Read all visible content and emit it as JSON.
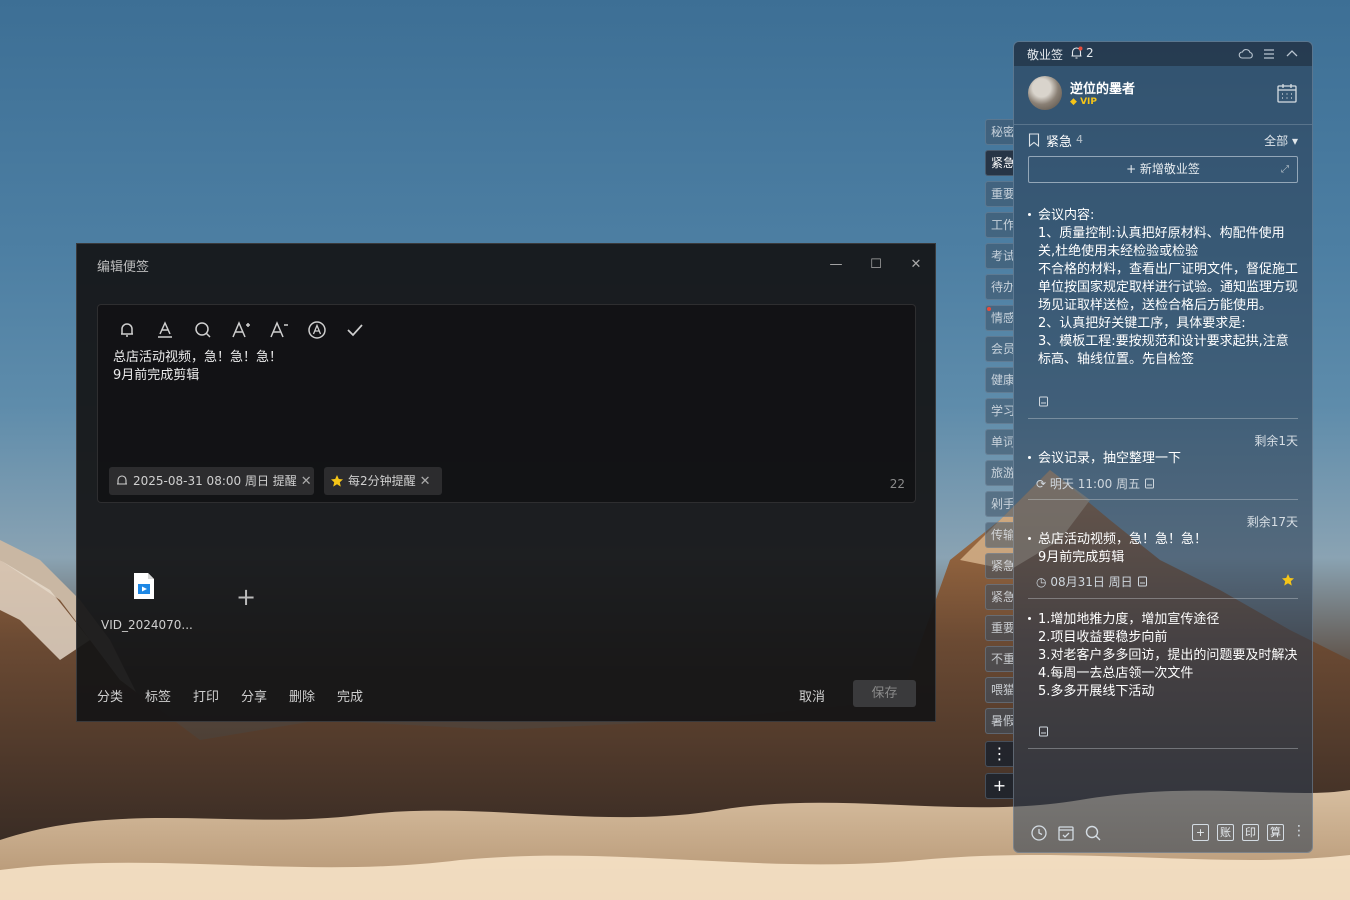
{
  "editor": {
    "title": "编辑便签",
    "note_line1": "总店活动视频，急！急！急！",
    "note_line2": "9月前完成剪辑",
    "reminder_tag": "2025-08-31 08:00 周日 提醒",
    "repeat_tag": "每2分钟提醒",
    "char_count": "22",
    "attachment_name": "VID_2024070...",
    "actions": [
      "分类",
      "标签",
      "打印",
      "分享",
      "删除",
      "完成"
    ],
    "cancel": "取消",
    "save": "保存"
  },
  "side_tabs": [
    "秘密",
    "紧急",
    "重要",
    "工作",
    "考试",
    "待办",
    "情感",
    "会员",
    "健康",
    "学习",
    "单词",
    "旅游",
    "剁手",
    "传输",
    "紧急",
    "紧急",
    "重要",
    "不重",
    "喂猫",
    "暑假"
  ],
  "panel": {
    "app_name": "敬业签",
    "notification_count": "2",
    "user_name": "逆位的墨者",
    "vip": "VIP",
    "category": "紧急",
    "category_count": "4",
    "filter": "全部",
    "new_note": "+ 新增敬业签",
    "notes": [
      {
        "text": "会议内容:\n1、质量控制:认真把好原材料、构配件使用关,杜绝使用未经检验或检验\n不合格的材料，查看出厂证明文件，督促施工单位按国家规定取样进行试验。通知监理方现场见证取样送检，送检合格后方能使用。\n2、认真把好关键工序，具体要求是:\n3、模板工程:要按规范和设计要求起拱,注意标高、轴线位置。先自检签"
      },
      {
        "remain": "剩余1天",
        "text": "会议记录，抽空整理一下",
        "meta": "明天 11:00 周五"
      },
      {
        "remain": "剩余17天",
        "text": "总店活动视频，急！急！急！\n9月前完成剪辑",
        "meta": "08月31日 周日"
      },
      {
        "text": "1.增加地推力度，增加宣传途径\n2.项目收益要稳步向前\n3.对老客户多多回访，提出的问题要及时解决\n4.每周一去总店领一次文件\n5.多多开展线下活动"
      }
    ],
    "footer_boxes": [
      "+",
      "账",
      "印",
      "算"
    ]
  },
  "colors": {
    "editor_bg": "#141416",
    "panel_bg": "#283a50",
    "vip": "#f5c518",
    "star": "#f5c518",
    "notification_dot": "#e74c3c"
  }
}
